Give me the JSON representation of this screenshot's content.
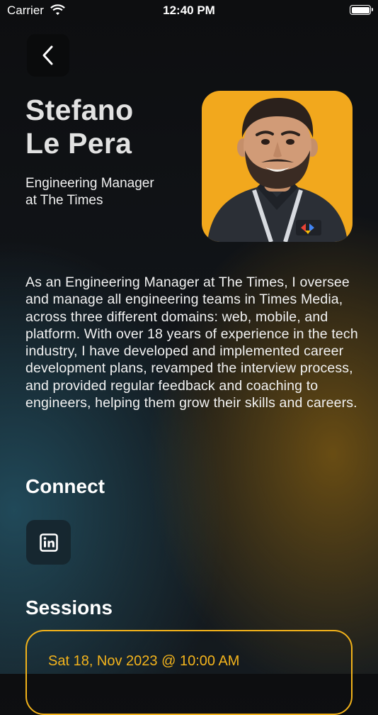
{
  "status_bar": {
    "carrier": "Carrier",
    "time": "12:40 PM",
    "icons": [
      "wifi-icon",
      "battery-icon"
    ]
  },
  "navigation": {
    "back_icon": "chevron-left-icon"
  },
  "speaker": {
    "name_line1": "Stefano",
    "name_line2": "Le Pera",
    "role_line1": "Engineering Manager",
    "role_line2": "at The Times",
    "bio": "As an Engineering Manager at The Times, I oversee and manage all engineering teams in Times Media, across three different domains: web, mobile, and platform. With over 18 years of experience in the tech industry, I have developed and implemented career development plans, revamped the interview process, and provided regular feedback and coaching to engineers, helping them grow their skills and careers.",
    "photo_background": "#f2a81d"
  },
  "connect": {
    "title": "Connect",
    "links": [
      {
        "icon": "linkedin-icon"
      }
    ]
  },
  "sessions": {
    "title": "Sessions",
    "items": [
      {
        "datetime": "Sat 18, Nov 2023 @ 10:00 AM"
      }
    ]
  },
  "colors": {
    "accent": "#f4b41c",
    "background": "#111418"
  }
}
